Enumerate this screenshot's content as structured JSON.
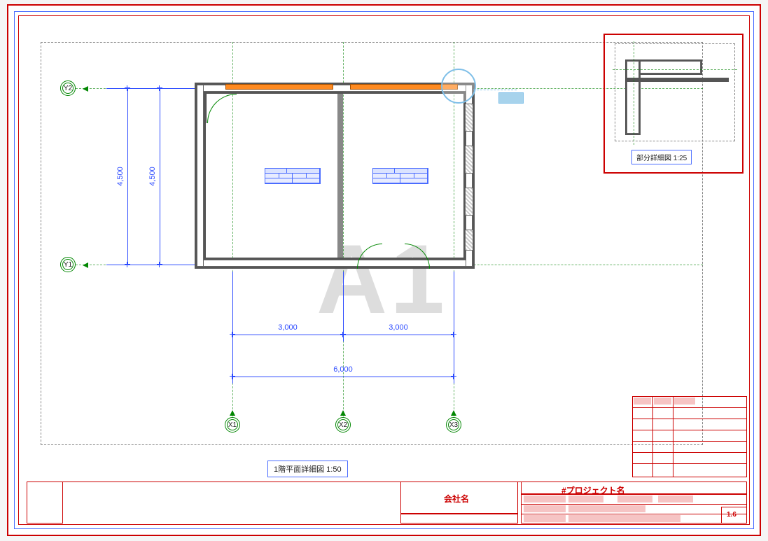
{
  "watermark": "A1",
  "grid": {
    "x_labels": [
      "X1",
      "X2",
      "X3"
    ],
    "y_labels": [
      "Y1",
      "Y2"
    ]
  },
  "dims": {
    "x1_x2": "3,000",
    "x2_x3": "3,000",
    "x1_x3": "6,000",
    "y1_y2_inner": "4,500",
    "y1_y2_outer": "4,500"
  },
  "views": {
    "main_title": "1階平面詳細図  1:50",
    "detail_title": "部分詳細図  1:25"
  },
  "titleblock": {
    "company": "会社名",
    "project": "#プロジェクト名",
    "version": "1.6"
  },
  "chart_data": {
    "type": "diagram",
    "drawing_type": "architectural floor plan (detail plan)",
    "sheet_size_watermark": "A1",
    "main_view": {
      "name_jp": "1階平面詳細図",
      "scale": "1:50",
      "room_count": 2,
      "structure": "two adjacent rectangular rooms separated by interior wall, exterior walls on all four sides",
      "grids": {
        "x": [
          "X1",
          "X2",
          "X3"
        ],
        "y": [
          "Y1",
          "Y2"
        ],
        "x_spacing_mm": {
          "X1-X2": 3000,
          "X2-X3": 3000,
          "X1-X3": 6000
        },
        "y_spacing_mm": {
          "Y1-Y2": 4500
        }
      },
      "annotations": [
        "two room-schedule tags inside rooms",
        "circular detail callout at top-right corner",
        "door swing bottom-right (double), door swing top-left"
      ]
    },
    "detail_view": {
      "name_jp": "部分詳細図",
      "scale": "1:25",
      "description": "enlarged corner wall junction from top-right of main plan"
    },
    "titleblock": {
      "company_box_label": "会社名",
      "project_label": "#プロジェクト名",
      "revision_table": "present, empty fields",
      "version": "1.6"
    }
  }
}
